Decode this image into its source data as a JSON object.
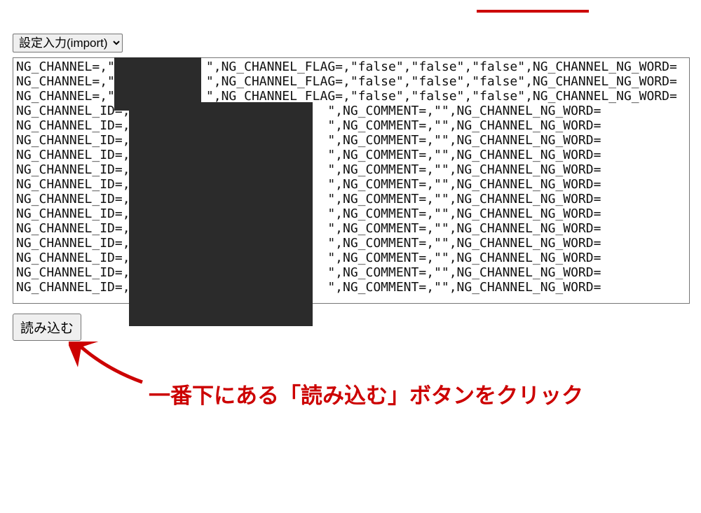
{
  "top_accent_color": "#cc0000",
  "select": {
    "label": "設定入力(import)",
    "options": [
      "設定入力(import)"
    ]
  },
  "textarea_lines": [
    "NG_CHANNEL=,\"            \",NG_CHANNEL_FLAG=,\"false\",\"false\",\"false\",NG_CHANNEL_NG_WORD=",
    "NG_CHANNEL=,\"            \",NG_CHANNEL_FLAG=,\"false\",\"false\",\"false\",NG_CHANNEL_NG_WORD=",
    "NG_CHANNEL=,\"            \",NG_CHANNEL_FLAG=,\"false\",\"false\",\"false\",NG_CHANNEL_NG_WORD=",
    "NG_CHANNEL_ID=,\"                         \",NG_COMMENT=,\"\",NG_CHANNEL_NG_WORD=",
    "NG_CHANNEL_ID=,\"                         \",NG_COMMENT=,\"\",NG_CHANNEL_NG_WORD=",
    "NG_CHANNEL_ID=,\"                         \",NG_COMMENT=,\"\",NG_CHANNEL_NG_WORD=",
    "NG_CHANNEL_ID=,\"                         \",NG_COMMENT=,\"\",NG_CHANNEL_NG_WORD=",
    "NG_CHANNEL_ID=,\"                         \",NG_COMMENT=,\"\",NG_CHANNEL_NG_WORD=",
    "NG_CHANNEL_ID=,\"                         \",NG_COMMENT=,\"\",NG_CHANNEL_NG_WORD=",
    "NG_CHANNEL_ID=,\"                         \",NG_COMMENT=,\"\",NG_CHANNEL_NG_WORD=",
    "NG_CHANNEL_ID=,\"                         \",NG_COMMENT=,\"\",NG_CHANNEL_NG_WORD=",
    "NG_CHANNEL_ID=,\"                         \",NG_COMMENT=,\"\",NG_CHANNEL_NG_WORD=",
    "NG_CHANNEL_ID=,\"                         \",NG_COMMENT=,\"\",NG_CHANNEL_NG_WORD=",
    "NG_CHANNEL_ID=,\"                         \",NG_COMMENT=,\"\",NG_CHANNEL_NG_WORD=",
    "NG_CHANNEL_ID=,\"                         \",NG_COMMENT=,\"\",NG_CHANNEL_NG_WORD=",
    "NG_CHANNEL_ID=,\"                         \",NG_COMMENT=,\"\",NG_CHANNEL_NG_WORD="
  ],
  "load_button_label": "読み込む",
  "annotation_text": "一番下にある「読み込む」ボタンをクリック",
  "annotation_color": "#cc0000"
}
